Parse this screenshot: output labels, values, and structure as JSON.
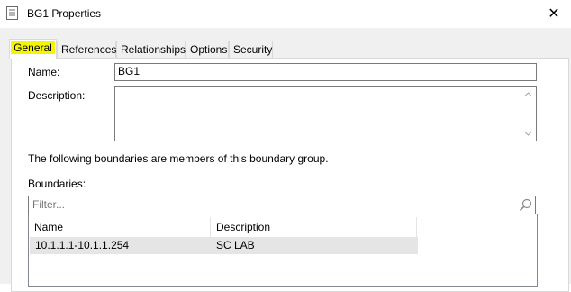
{
  "window": {
    "title": "BG1 Properties",
    "close_glyph": "✕"
  },
  "tabs": [
    {
      "label": "General",
      "active": true
    },
    {
      "label": "References",
      "active": false
    },
    {
      "label": "Relationships",
      "active": false
    },
    {
      "label": "Options",
      "active": false
    },
    {
      "label": "Security",
      "active": false
    }
  ],
  "form": {
    "name_label": "Name:",
    "name_value": "BG1",
    "description_label": "Description:",
    "description_value": "",
    "members_text": "The following boundaries are members of this boundary group.",
    "boundaries_label": "Boundaries:",
    "filter_placeholder": "Filter..."
  },
  "boundaries": {
    "columns": [
      "Name",
      "Description"
    ],
    "rows": [
      [
        "10.1.1.1-10.1.1.254",
        "SC LAB"
      ]
    ]
  },
  "colors": {
    "highlight": "#f5f500",
    "dialog_bg": "#f0f0f0",
    "selected_row": "#e5e5e5"
  },
  "icons": {
    "title": "properties-page-icon",
    "close": "close-icon",
    "search": "search-icon",
    "scroll_up": "scroll-up-arrow-icon",
    "scroll_down": "scroll-down-arrow-icon"
  }
}
